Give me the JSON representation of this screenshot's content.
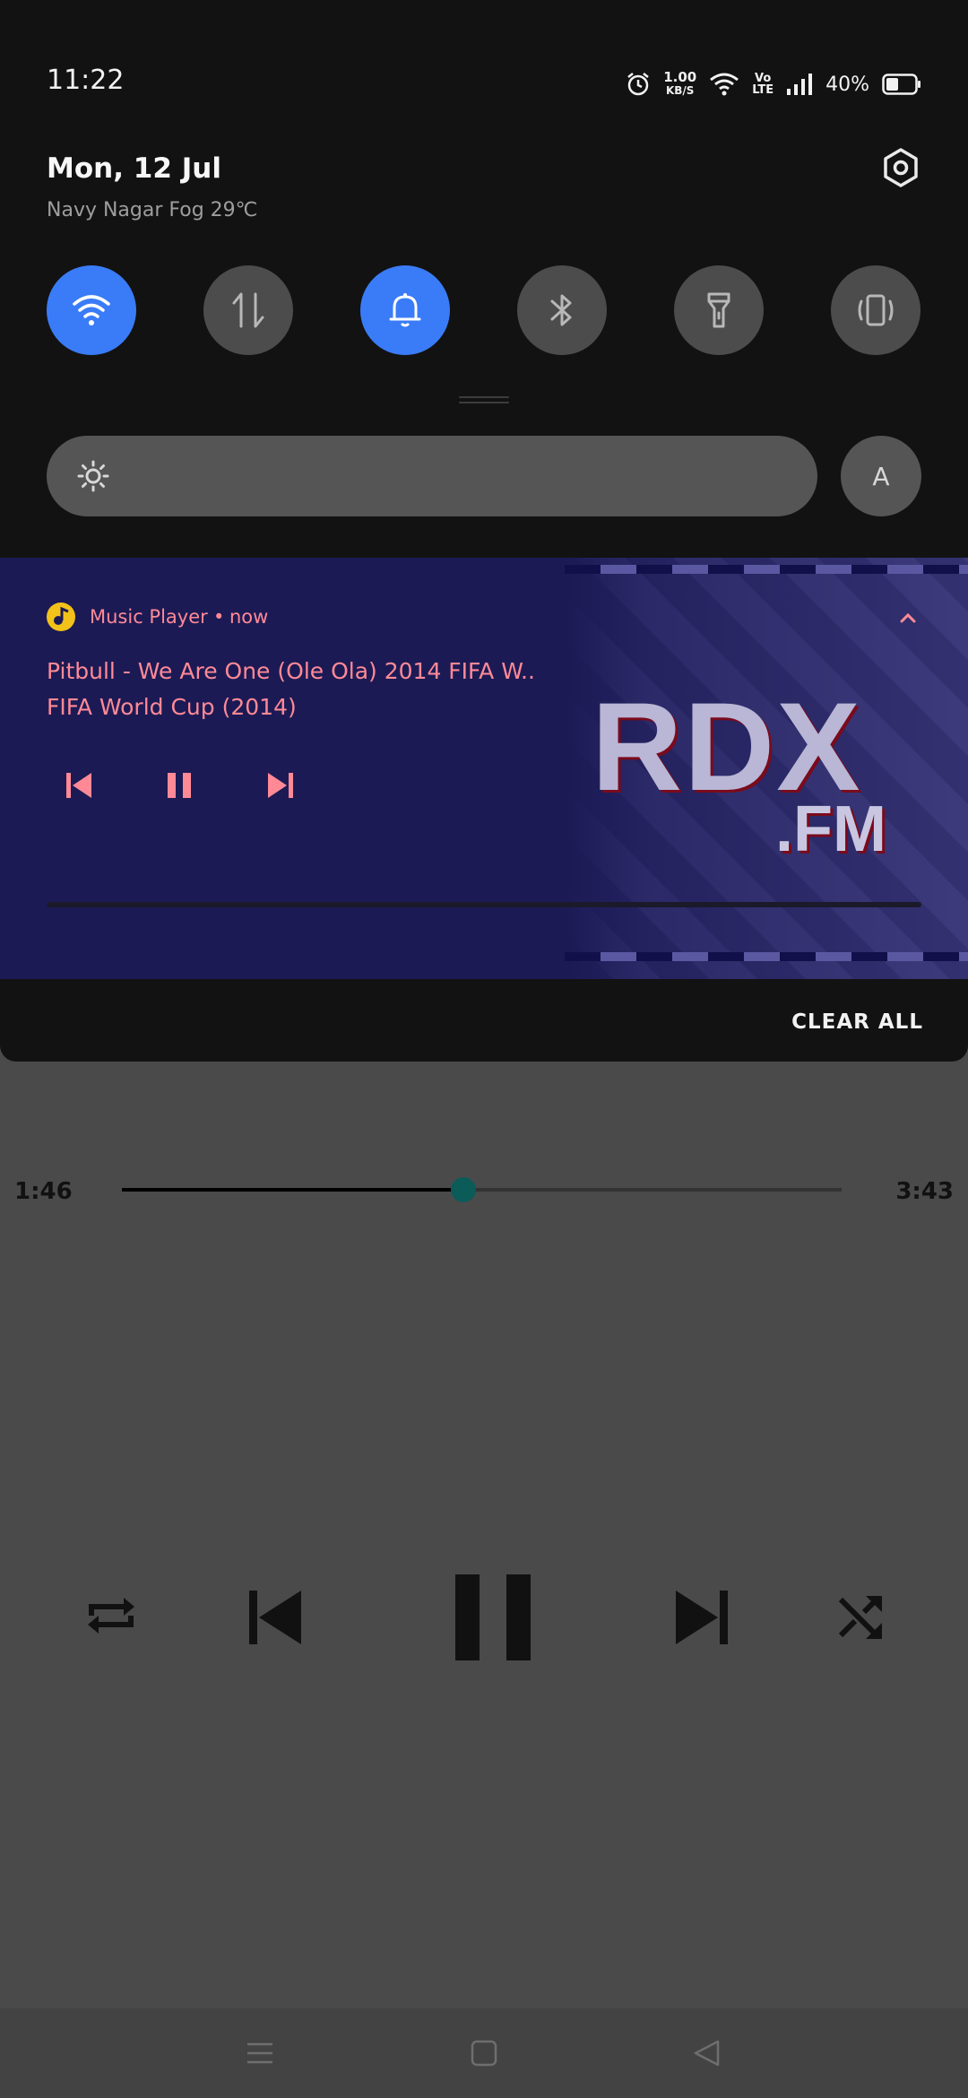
{
  "status_bar": {
    "time": "11:22",
    "net_speed_value": "1.00",
    "net_speed_unit": "KB/S",
    "volte_top": "Vo",
    "volte_bottom": "LTE",
    "battery": "40%"
  },
  "header": {
    "date": "Mon, 12 Jul",
    "weather": "Navy Nagar Fog 29℃"
  },
  "quick_tiles": [
    {
      "name": "wifi",
      "icon": "wifi-icon",
      "active": true
    },
    {
      "name": "mobile-data",
      "icon": "data-arrows-icon",
      "active": false
    },
    {
      "name": "sound",
      "icon": "bell-icon",
      "active": true
    },
    {
      "name": "bluetooth",
      "icon": "bluetooth-icon",
      "active": false
    },
    {
      "name": "flashlight",
      "icon": "flashlight-icon",
      "active": false
    },
    {
      "name": "vibrate",
      "icon": "vibrate-icon",
      "active": false
    }
  ],
  "brightness": {
    "auto_label": "A"
  },
  "media_notification": {
    "app_name": "Music Player",
    "separator": "•",
    "time": "now",
    "title": "Pitbull - We Are One (Ole Ola) 2014 FIFA W..",
    "album": "FIFA World Cup (2014)",
    "album_art_text_1": "RDX",
    "album_art_text_2": ".FM",
    "progress": 0.0
  },
  "clear_all_label": "CLEAR ALL",
  "player": {
    "current_time": "1:46",
    "total_time": "3:43",
    "progress": 0.475
  },
  "colors": {
    "accent_blue": "#3a7cf7",
    "notification_text": "#ff8a96",
    "media_bg": "#1c1a55",
    "seek_thumb": "#0b5b58"
  }
}
